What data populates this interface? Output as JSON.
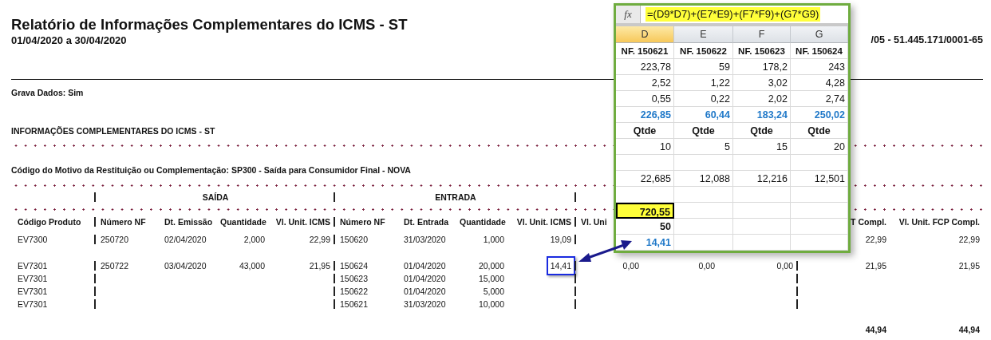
{
  "report": {
    "title": "Relatório de Informações Complementares do ICMS - ST",
    "period": "01/04/2020 a 30/04/2020",
    "company": "/05 - 51.445.171/0001-65",
    "grava_dados": "Grava Dados: Sim",
    "section_title": "INFORMAÇÕES COMPLEMENTARES DO ICMS - ST",
    "motivo": "Código do Motivo da Restituição ou Complementação: SP300 - Saída para Consumidor Final - NOVA"
  },
  "table": {
    "groups": [
      "SAÍDA",
      "ENTRADA"
    ],
    "columns": {
      "product": "Código Produto",
      "saida_nf": "Número NF",
      "dt_emissao": "Dt. Emissão",
      "saida_qtd": "Quantidade",
      "saida_vl": "Vl. Unit. ICMS",
      "entrada_nf": "Número NF",
      "dt_entrada": "Dt. Entrada",
      "entrada_qtd": "Quantidade",
      "entrada_vl": "Vl. Unit. ICMS",
      "column_10": "Vl. Uni",
      "column_13": "T Compl.",
      "column_14": "Vl. Unit. FCP Compl."
    },
    "products": [
      {
        "rows": [
          {
            "product": "EV7300",
            "saida_nf": "250720",
            "dt_emissao": "02/04/2020",
            "saida_qtd": "2,000",
            "saida_vl": "22,99",
            "entrada_nf": "150620",
            "dt_entrada": "31/03/2020",
            "entrada_qtd": "1,000",
            "entrada_vl": "19,09",
            "column_13": "22,99",
            "column_14": "22,99",
            "highlighted": false
          }
        ]
      },
      {
        "rows": [
          {
            "product": "EV7301",
            "saida_nf": "250722",
            "dt_emissao": "03/04/2020",
            "saida_qtd": "43,000",
            "saida_vl": "21,95",
            "entrada_nf": "150624",
            "dt_entrada": "01/04/2020",
            "entrada_qtd": "20,000",
            "entrada_vl": "14,41",
            "column_10": "0,00",
            "column_11": "0,00",
            "column_12": "0,00",
            "column_13": "21,95",
            "column_14": "21,95",
            "highlighted": true
          },
          {
            "product": "EV7301",
            "entrada_nf": "150623",
            "dt_entrada": "01/04/2020",
            "entrada_qtd": "15,000"
          },
          {
            "product": "EV7301",
            "entrada_nf": "150622",
            "dt_entrada": "01/04/2020",
            "entrada_qtd": "5,000"
          },
          {
            "product": "EV7301",
            "entrada_nf": "150621",
            "dt_entrada": "31/03/2020",
            "entrada_qtd": "10,000"
          }
        ]
      }
    ],
    "totals": {
      "column_13": "44,94",
      "column_14": "44,94"
    }
  },
  "sheet": {
    "function_icon": "fx",
    "formula": "=(D9*D7)+(E7*E9)+(F7*F9)+(G7*G9)",
    "columns": [
      {
        "label": "D",
        "selected": true
      },
      {
        "label": "E",
        "selected": false
      },
      {
        "label": "F",
        "selected": false
      },
      {
        "label": "G",
        "selected": false
      }
    ],
    "rows": [
      {
        "kind": "label",
        "cells": [
          "NF. 150621",
          "NF. 150622",
          "NF. 150623",
          "NF. 150624"
        ]
      },
      {
        "kind": "number",
        "cells": [
          "223,78",
          "59",
          "178,2",
          "243"
        ]
      },
      {
        "kind": "number",
        "cells": [
          "2,52",
          "1,22",
          "3,02",
          "4,28"
        ]
      },
      {
        "kind": "number",
        "cells": [
          "0,55",
          "0,22",
          "2,02",
          "2,74"
        ]
      },
      {
        "kind": "sum",
        "cells": [
          "226,85",
          "60,44",
          "183,24",
          "250,02"
        ]
      },
      {
        "kind": "caption",
        "cells": [
          "Qtde",
          "Qtde",
          "Qtde",
          "Qtde"
        ]
      },
      {
        "kind": "number",
        "cells": [
          "10",
          "5",
          "15",
          "20"
        ]
      },
      {
        "kind": "blank"
      },
      {
        "kind": "number",
        "cells": [
          "22,685",
          "12,088",
          "12,216",
          "12,501"
        ]
      },
      {
        "kind": "blank"
      },
      {
        "kind": "active",
        "cells": [
          "720,55"
        ]
      },
      {
        "kind": "bold",
        "cells": [
          "50"
        ]
      },
      {
        "kind": "result",
        "cells": [
          "14,41"
        ]
      }
    ]
  }
}
